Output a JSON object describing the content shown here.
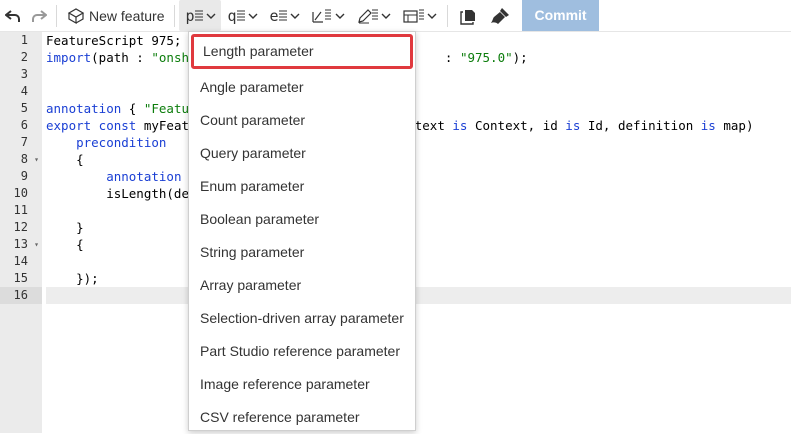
{
  "toolbar": {
    "undo_icon": "undo-icon",
    "redo_icon": "redo-icon",
    "new_feature_label": "New feature",
    "param_glyph": "p",
    "query_glyph": "q",
    "enum_glyph": "e",
    "commit_label": "Commit"
  },
  "editor": {
    "line_numbers": [
      "1",
      "2",
      "3",
      "4",
      "5",
      "6",
      "7",
      "8",
      "9",
      "10",
      "11",
      "12",
      "13",
      "14",
      "15",
      "16"
    ],
    "active_line": 16
  },
  "dropdown": {
    "items": [
      "Length parameter",
      "Angle parameter",
      "Count parameter",
      "Query parameter",
      "Enum parameter",
      "Boolean parameter",
      "String parameter",
      "Array parameter",
      "Selection-driven array parameter",
      "Part Studio reference parameter",
      "Image reference parameter",
      "CSV reference parameter"
    ],
    "highlight_color": "#e0393e"
  },
  "colors": {
    "keyword": "#1a3fd4",
    "string": "#0c7d0c",
    "commit_bg": "#9fbedf"
  }
}
